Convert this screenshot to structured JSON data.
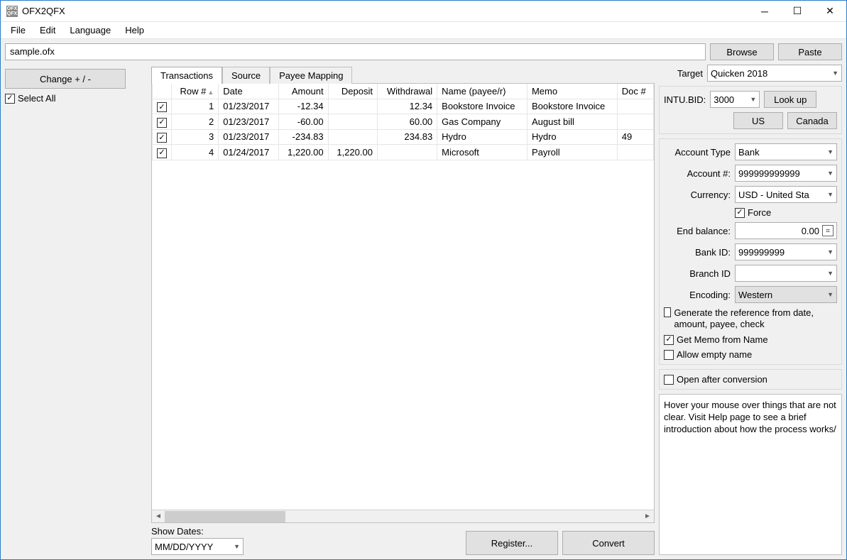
{
  "window": {
    "title": "OFX2QFX"
  },
  "menu": {
    "file": "File",
    "edit": "Edit",
    "language": "Language",
    "help": "Help"
  },
  "filepath": "sample.ofx",
  "browse": "Browse",
  "paste": "Paste",
  "change_btn": "Change + / -",
  "select_all": "Select All",
  "tabs": {
    "transactions": "Transactions",
    "source": "Source",
    "payee_mapping": "Payee Mapping"
  },
  "columns": {
    "row": "Row #",
    "date": "Date",
    "amount": "Amount",
    "deposit": "Deposit",
    "withdrawal": "Withdrawal",
    "name": "Name (payee/r)",
    "memo": "Memo",
    "doc": "Doc #"
  },
  "rows": [
    {
      "row": "1",
      "date": "01/23/2017",
      "amount": "-12.34",
      "deposit": "",
      "withdrawal": "12.34",
      "name": "Bookstore Invoice",
      "memo": "Bookstore Invoice",
      "doc": ""
    },
    {
      "row": "2",
      "date": "01/23/2017",
      "amount": "-60.00",
      "deposit": "",
      "withdrawal": "60.00",
      "name": "Gas Company",
      "memo": "August bill",
      "doc": ""
    },
    {
      "row": "3",
      "date": "01/23/2017",
      "amount": "-234.83",
      "deposit": "",
      "withdrawal": "234.83",
      "name": "Hydro",
      "memo": "Hydro",
      "doc": "49"
    },
    {
      "row": "4",
      "date": "01/24/2017",
      "amount": "1,220.00",
      "deposit": "1,220.00",
      "withdrawal": "",
      "name": "Microsoft",
      "memo": "Payroll",
      "doc": ""
    }
  ],
  "show_dates_label": "Show Dates:",
  "show_dates_value": "MM/DD/YYYY",
  "register_btn": "Register...",
  "convert_btn": "Convert",
  "target_label": "Target",
  "target_value": "Quicken 2018",
  "intu_label": "INTU.BID:",
  "intu_value": "3000",
  "lookup_btn": "Look up",
  "us_btn": "US",
  "canada_btn": "Canada",
  "account_type_label": "Account Type",
  "account_type_value": "Bank",
  "account_num_label": "Account #:",
  "account_num_value": "999999999999",
  "currency_label": "Currency:",
  "currency_value": "USD - United Sta",
  "force_label": "Force",
  "end_balance_label": "End balance:",
  "end_balance_value": "0.00",
  "bank_id_label": "Bank ID:",
  "bank_id_value": "999999999",
  "branch_id_label": "Branch ID",
  "branch_id_value": "",
  "encoding_label": "Encoding:",
  "encoding_value": "Western",
  "gen_ref_label": "Generate the reference from date, amount, payee, check",
  "get_memo_label": "Get Memo from Name",
  "allow_empty_label": "Allow empty name",
  "open_after_label": "Open after conversion",
  "hint_text": "Hover your mouse over things that are not clear. Visit Help page to see a brief introduction about how the process works/"
}
